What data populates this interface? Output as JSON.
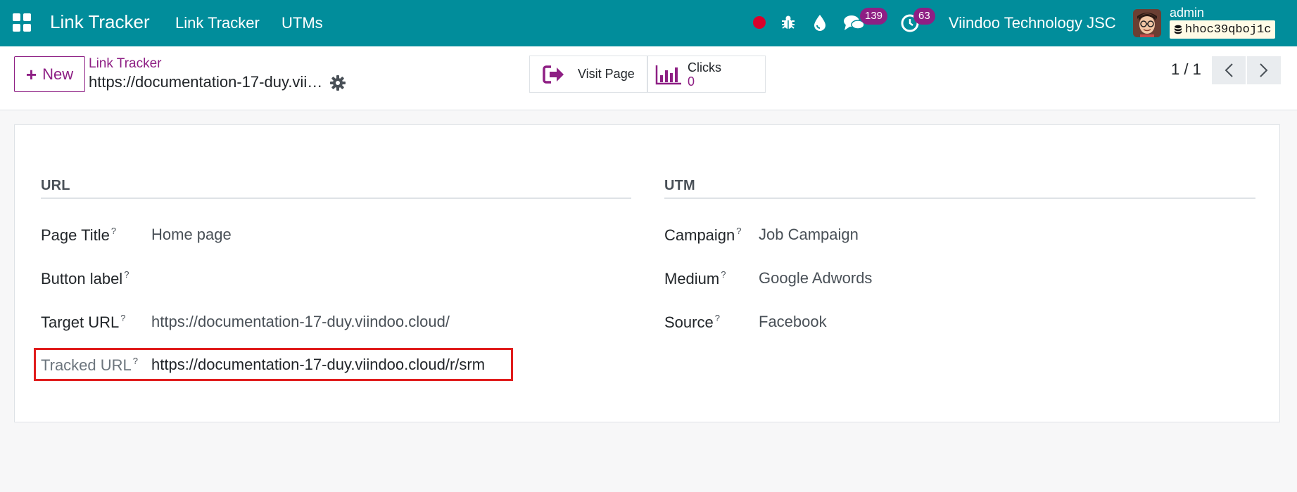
{
  "navbar": {
    "app_title": "Link Tracker",
    "menu": [
      "Link Tracker",
      "UTMs"
    ],
    "icons": [
      "apps-icon",
      "record-icon",
      "bug-icon",
      "drop-icon",
      "chat-icon",
      "activity-clock-icon"
    ],
    "chat_badge": "139",
    "activity_badge": "63",
    "company": "Viindoo Technology JSC",
    "user": "admin",
    "database": "hhoc39qboj1c",
    "colors": {
      "bar": "#018d9b",
      "badge": "#8e1f84",
      "record": "#d9002b"
    }
  },
  "control": {
    "new_label": "New",
    "breadcrumb": "Link Tracker",
    "record_name": "https://documentation-17-duy.viindoo.cloud/r/srm",
    "visit_label": "Visit Page",
    "clicks_label": "Clicks",
    "clicks_value": "0",
    "pager": "1 / 1"
  },
  "form": {
    "url_group": {
      "title": "URL",
      "page_title_label": "Page Title",
      "page_title_value": "Home page",
      "button_label_label": "Button label",
      "button_label_value": "",
      "target_url_label": "Target URL",
      "target_url_value": "https://documentation-17-duy.viindoo.cloud/",
      "tracked_url_label": "Tracked URL",
      "tracked_url_value": "https://documentation-17-duy.viindoo.cloud/r/srm"
    },
    "utm_group": {
      "title": "UTM",
      "campaign_label": "Campaign",
      "campaign_value": "Job Campaign",
      "medium_label": "Medium",
      "medium_value": "Google Adwords",
      "source_label": "Source",
      "source_value": "Facebook"
    },
    "help_mark": "?"
  },
  "accent_color": "#8e1f84",
  "highlight_color": "#e01c1c"
}
